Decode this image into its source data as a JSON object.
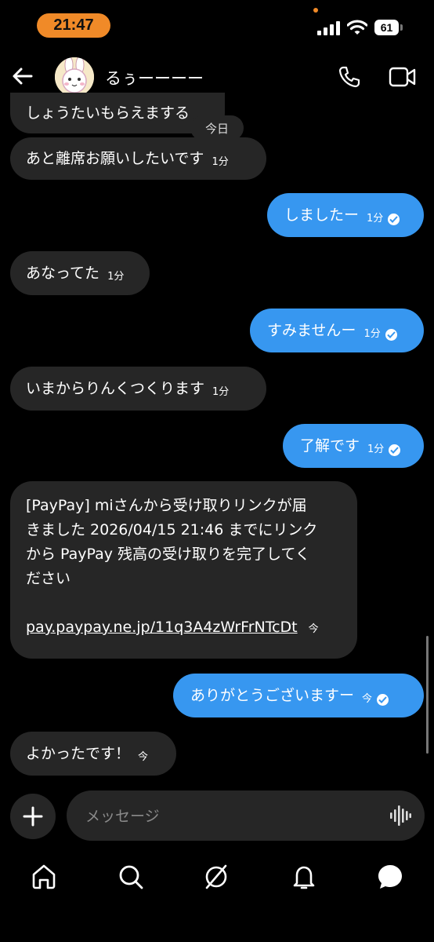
{
  "status_bar": {
    "time": "21:47",
    "battery": "61"
  },
  "header": {
    "contact_name": "るぅーーーー"
  },
  "date_separator": "今日",
  "messages": [
    {
      "dir": "in",
      "text": "しょうたいもらえまする",
      "time": ""
    },
    {
      "dir": "in",
      "text": "あと離席お願いしたいです",
      "time": "1分"
    },
    {
      "dir": "out",
      "text": "しましたー",
      "time": "1分"
    },
    {
      "dir": "in",
      "text": "あなってた",
      "time": "1分"
    },
    {
      "dir": "out",
      "text": "すみませんー",
      "time": "1分"
    },
    {
      "dir": "in",
      "text": "いまからりんくつくります",
      "time": "1分"
    },
    {
      "dir": "out",
      "text": "了解です",
      "time": "1分"
    },
    {
      "dir": "out",
      "text": "ありがとうございますー",
      "time": "今"
    },
    {
      "dir": "in",
      "text": "よかったです！",
      "time": "今"
    }
  ],
  "paypay_message": {
    "line1": "[PayPay] miさんから受け取りリンクが届",
    "line2": "きました 2026/04/15 21:46 までにリンク",
    "line3": "から PayPay 残高の受け取りを完了してく",
    "line4": "ださい",
    "link": "pay.paypay.ne.jp/11q3A4zWrFrNTcDt",
    "time": "今"
  },
  "composer": {
    "placeholder": "メッセージ"
  },
  "nav": {
    "items": [
      "home-icon",
      "search-icon",
      "explore-icon",
      "notifications-icon",
      "messages-icon"
    ]
  }
}
